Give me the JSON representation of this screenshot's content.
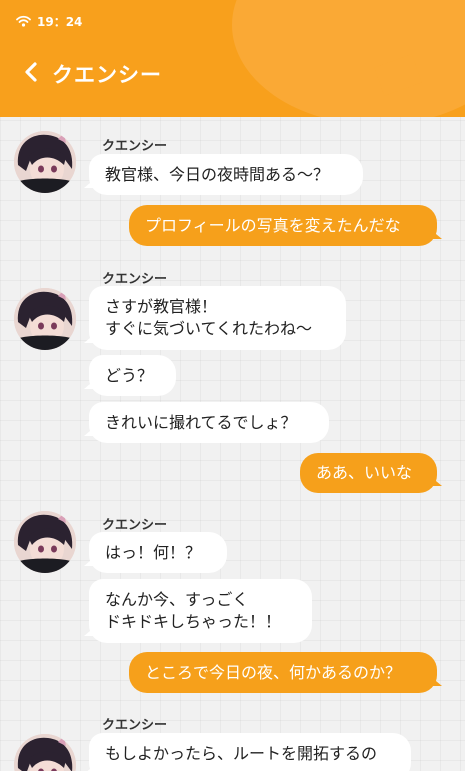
{
  "status_bar": {
    "time": "19：24",
    "wifi_icon": "wifi-icon"
  },
  "header": {
    "title": "クエンシー",
    "back_icon": "chevron-left-icon"
  },
  "colors": {
    "accent": "#f8a01c",
    "bubble_out": "#f6a01b",
    "bubble_in": "#ffffff",
    "background": "#f1f1f1"
  },
  "chat": {
    "group1": {
      "sender": "クエンシー",
      "m1": "教官様、今日の夜時間ある～？"
    },
    "reply1": "プロフィールの写真を変えたんだな",
    "group2": {
      "sender": "クエンシー",
      "m1": "さすが教官様！\nすぐに気づいてくれたわね～",
      "m2": "どう？",
      "m3": "きれいに撮れてるでしょ？"
    },
    "reply2": "ああ、いいな",
    "group3": {
      "sender": "クエンシー",
      "m1": "はっ！何！？",
      "m2": "なんか今、すっごく\nドキドキしちゃった！！"
    },
    "reply3": "ところで今日の夜、何かあるのか？",
    "group4": {
      "sender": "クエンシー",
      "m1": "もしよかったら、ルートを開拓するの"
    }
  }
}
